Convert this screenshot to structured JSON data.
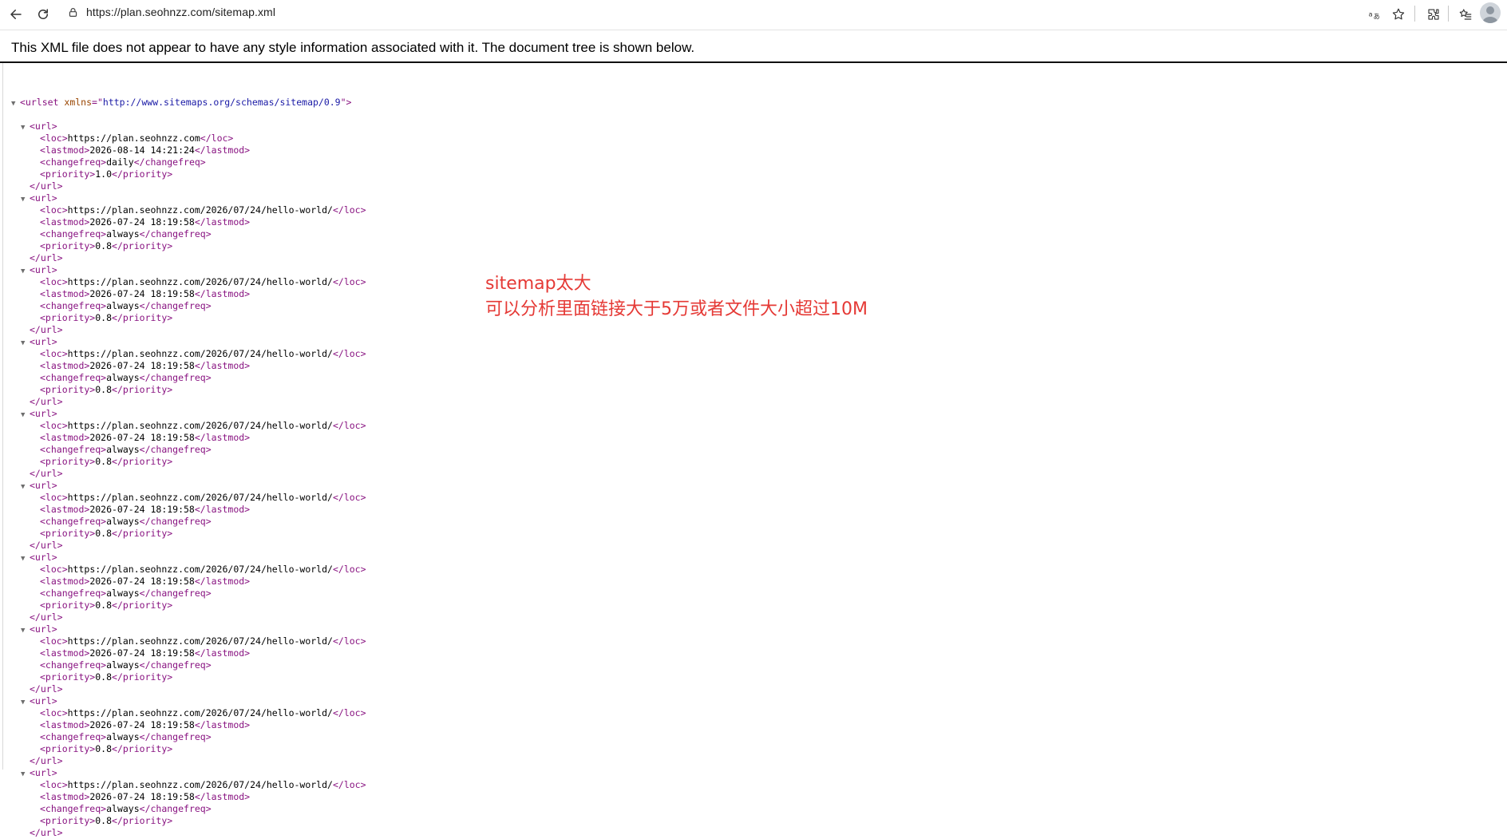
{
  "browser": {
    "url": "https://plan.seohnzz.com/sitemap.xml",
    "icons": [
      "back-icon",
      "reload-icon",
      "lock-icon",
      "translate-icon",
      "star-icon",
      "extensions-icon",
      "favorites-icon",
      "profile-icon"
    ]
  },
  "page": {
    "info_text": "This XML file does not appear to have any style information associated with it. The document tree is shown below."
  },
  "xml": {
    "root_open_tag": "<urlset",
    "root_attr_name": "xmlns",
    "root_attr_eq": "=\"",
    "root_attr_value": "http://www.sitemaps.org/schemas/sitemap/0.9",
    "root_attr_close": "\">",
    "url_open": "<url>",
    "url_close": "</url>",
    "entries": [
      {
        "loc": "https://plan.seohnzz.com",
        "lastmod": "2026-08-14 14:21:24",
        "changefreq": "daily",
        "priority": "1.0"
      },
      {
        "loc": "https://plan.seohnzz.com/2026/07/24/hello-world/",
        "lastmod": "2026-07-24 18:19:58",
        "changefreq": "always",
        "priority": "0.8"
      },
      {
        "loc": "https://plan.seohnzz.com/2026/07/24/hello-world/",
        "lastmod": "2026-07-24 18:19:58",
        "changefreq": "always",
        "priority": "0.8"
      },
      {
        "loc": "https://plan.seohnzz.com/2026/07/24/hello-world/",
        "lastmod": "2026-07-24 18:19:58",
        "changefreq": "always",
        "priority": "0.8"
      },
      {
        "loc": "https://plan.seohnzz.com/2026/07/24/hello-world/",
        "lastmod": "2026-07-24 18:19:58",
        "changefreq": "always",
        "priority": "0.8"
      },
      {
        "loc": "https://plan.seohnzz.com/2026/07/24/hello-world/",
        "lastmod": "2026-07-24 18:19:58",
        "changefreq": "always",
        "priority": "0.8"
      },
      {
        "loc": "https://plan.seohnzz.com/2026/07/24/hello-world/",
        "lastmod": "2026-07-24 18:19:58",
        "changefreq": "always",
        "priority": "0.8"
      },
      {
        "loc": "https://plan.seohnzz.com/2026/07/24/hello-world/",
        "lastmod": "2026-07-24 18:19:58",
        "changefreq": "always",
        "priority": "0.8"
      },
      {
        "loc": "https://plan.seohnzz.com/2026/07/24/hello-world/",
        "lastmod": "2026-07-24 18:19:58",
        "changefreq": "always",
        "priority": "0.8"
      },
      {
        "loc": "https://plan.seohnzz.com/2026/07/24/hello-world/",
        "lastmod": "2026-07-24 18:19:58",
        "changefreq": "always",
        "priority": "0.8"
      }
    ]
  },
  "annotation": {
    "line1": "sitemap太大",
    "line2": "可以分析里面链接大于5万或者文件大小超过10M",
    "color": "#e53935"
  }
}
